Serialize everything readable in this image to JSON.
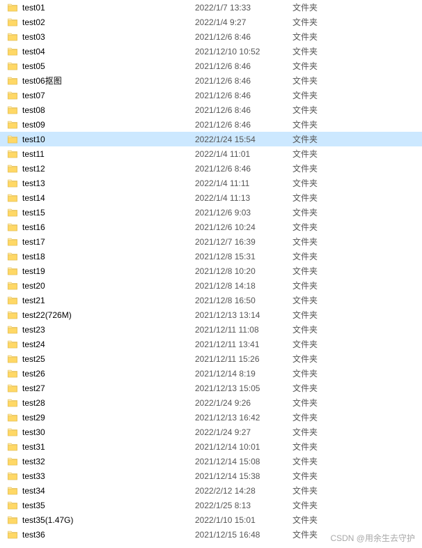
{
  "watermark": "CSDN @用余生去守护",
  "type_label": "文件夹",
  "selected_index": 9,
  "files": [
    {
      "name": "test01",
      "date": "2022/1/7 13:33",
      "type": "文件夹"
    },
    {
      "name": "test02",
      "date": "2022/1/4 9:27",
      "type": "文件夹"
    },
    {
      "name": "test03",
      "date": "2021/12/6 8:46",
      "type": "文件夹"
    },
    {
      "name": "test04",
      "date": "2021/12/10 10:52",
      "type": "文件夹"
    },
    {
      "name": "test05",
      "date": "2021/12/6 8:46",
      "type": "文件夹"
    },
    {
      "name": "test06抠图",
      "date": "2021/12/6 8:46",
      "type": "文件夹"
    },
    {
      "name": "test07",
      "date": "2021/12/6 8:46",
      "type": "文件夹"
    },
    {
      "name": "test08",
      "date": "2021/12/6 8:46",
      "type": "文件夹"
    },
    {
      "name": "test09",
      "date": "2021/12/6 8:46",
      "type": "文件夹"
    },
    {
      "name": "test10",
      "date": "2022/1/24 15:54",
      "type": "文件夹"
    },
    {
      "name": "test11",
      "date": "2022/1/4 11:01",
      "type": "文件夹"
    },
    {
      "name": "test12",
      "date": "2021/12/6 8:46",
      "type": "文件夹"
    },
    {
      "name": "test13",
      "date": "2022/1/4 11:11",
      "type": "文件夹"
    },
    {
      "name": "test14",
      "date": "2022/1/4 11:13",
      "type": "文件夹"
    },
    {
      "name": "test15",
      "date": "2021/12/6 9:03",
      "type": "文件夹"
    },
    {
      "name": "test16",
      "date": "2021/12/6 10:24",
      "type": "文件夹"
    },
    {
      "name": "test17",
      "date": "2021/12/7 16:39",
      "type": "文件夹"
    },
    {
      "name": "test18",
      "date": "2021/12/8 15:31",
      "type": "文件夹"
    },
    {
      "name": "test19",
      "date": "2021/12/8 10:20",
      "type": "文件夹"
    },
    {
      "name": "test20",
      "date": "2021/12/8 14:18",
      "type": "文件夹"
    },
    {
      "name": "test21",
      "date": "2021/12/8 16:50",
      "type": "文件夹"
    },
    {
      "name": "test22(726M)",
      "date": "2021/12/13 13:14",
      "type": "文件夹"
    },
    {
      "name": "test23",
      "date": "2021/12/11 11:08",
      "type": "文件夹"
    },
    {
      "name": "test24",
      "date": "2021/12/11 13:41",
      "type": "文件夹"
    },
    {
      "name": "test25",
      "date": "2021/12/11 15:26",
      "type": "文件夹"
    },
    {
      "name": "test26",
      "date": "2021/12/14 8:19",
      "type": "文件夹"
    },
    {
      "name": "test27",
      "date": "2021/12/13 15:05",
      "type": "文件夹"
    },
    {
      "name": "test28",
      "date": "2022/1/24 9:26",
      "type": "文件夹"
    },
    {
      "name": "test29",
      "date": "2021/12/13 16:42",
      "type": "文件夹"
    },
    {
      "name": "test30",
      "date": "2022/1/24 9:27",
      "type": "文件夹"
    },
    {
      "name": "test31",
      "date": "2021/12/14 10:01",
      "type": "文件夹"
    },
    {
      "name": "test32",
      "date": "2021/12/14 15:08",
      "type": "文件夹"
    },
    {
      "name": "test33",
      "date": "2021/12/14 15:38",
      "type": "文件夹"
    },
    {
      "name": "test34",
      "date": "2022/2/12 14:28",
      "type": "文件夹"
    },
    {
      "name": "test35",
      "date": "2022/1/25 8:13",
      "type": "文件夹"
    },
    {
      "name": "test35(1.47G)",
      "date": "2022/1/10 15:01",
      "type": "文件夹"
    },
    {
      "name": "test36",
      "date": "2021/12/15 16:48",
      "type": "文件夹"
    }
  ]
}
